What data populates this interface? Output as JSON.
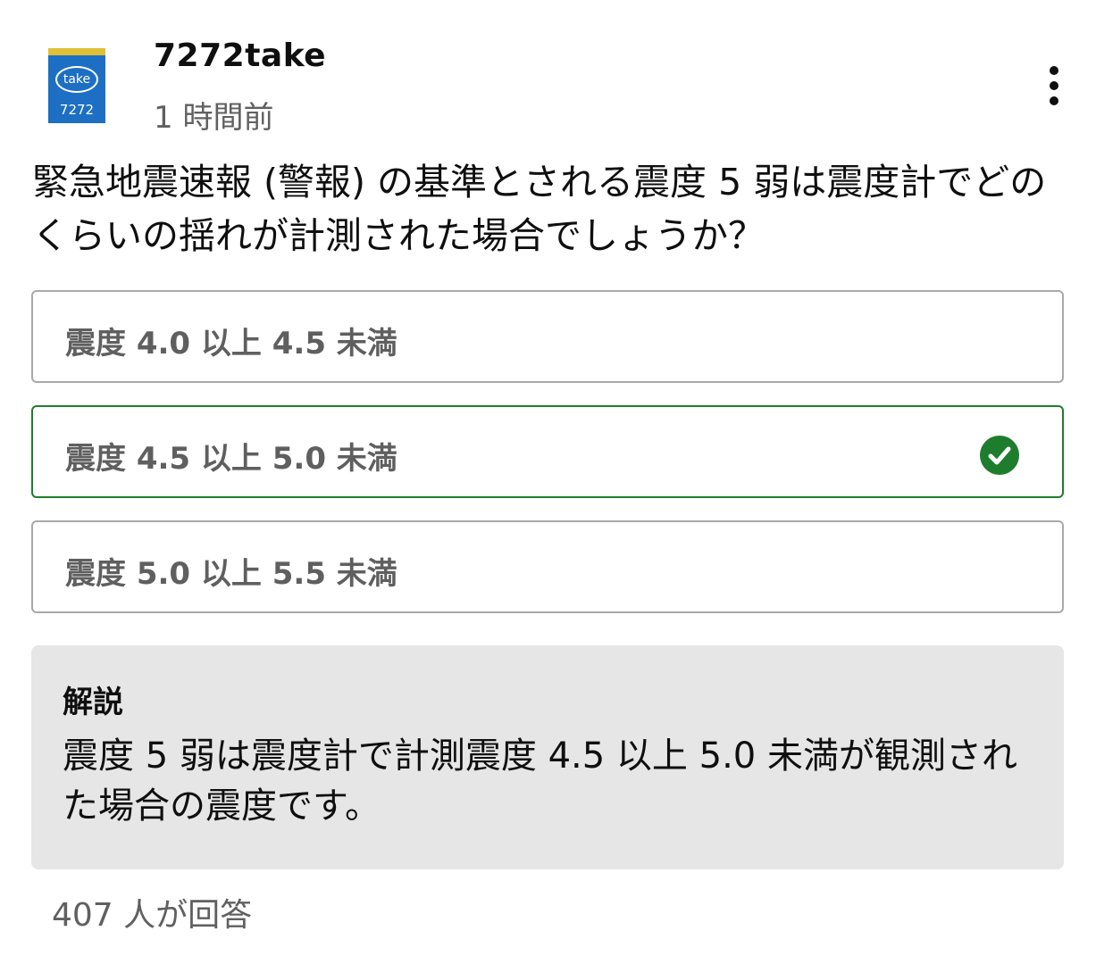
{
  "post": {
    "channel": {
      "name": "7272take",
      "avatar_text_top": "take",
      "avatar_text_bottom": "7272"
    },
    "timestamp": "1 時間前",
    "more_icon": "vertical-ellipsis-icon"
  },
  "quiz": {
    "question": "緊急地震速報 (警報) の基準とされる震度 5 弱は震度計でどのくらいの揺れが計測された場合でしょうか？",
    "options": [
      {
        "label": "震度 4.0 以上 4.5 未満",
        "correct": false
      },
      {
        "label": "震度 4.5 以上 5.0 未満",
        "correct": true
      },
      {
        "label": "震度 5.0 以上 5.5 未満",
        "correct": false
      }
    ],
    "explanation": {
      "title": "解説",
      "body": "震度 5 弱は震度計で計測震度 4.5 以上 5.0 未満が観測された場合の震度です。"
    },
    "answer_count": "407 人が回答"
  },
  "colors": {
    "correct": "#1e7d2c",
    "option_border": "#a9a9a9",
    "explanation_bg": "#e6e6e6"
  }
}
